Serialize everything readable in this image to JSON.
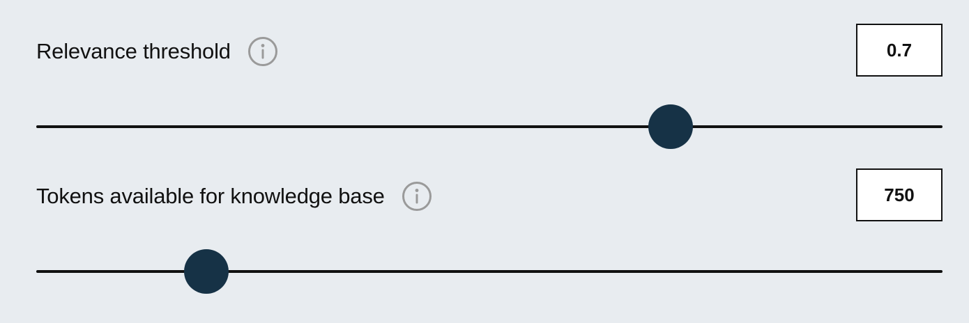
{
  "settings": [
    {
      "label": "Relevance threshold",
      "value": "0.7",
      "slider": {
        "min": 0,
        "max": 1,
        "value": 0.7
      }
    },
    {
      "label": "Tokens available for knowledge base",
      "value": "750",
      "slider": {
        "min": 0,
        "max": 4000,
        "value": 750
      }
    }
  ],
  "icons": {
    "info": "info-icon"
  },
  "colors": {
    "background": "#e8ecf0",
    "thumb": "#163246",
    "track": "#111111",
    "icon": "#9a9a9a"
  }
}
